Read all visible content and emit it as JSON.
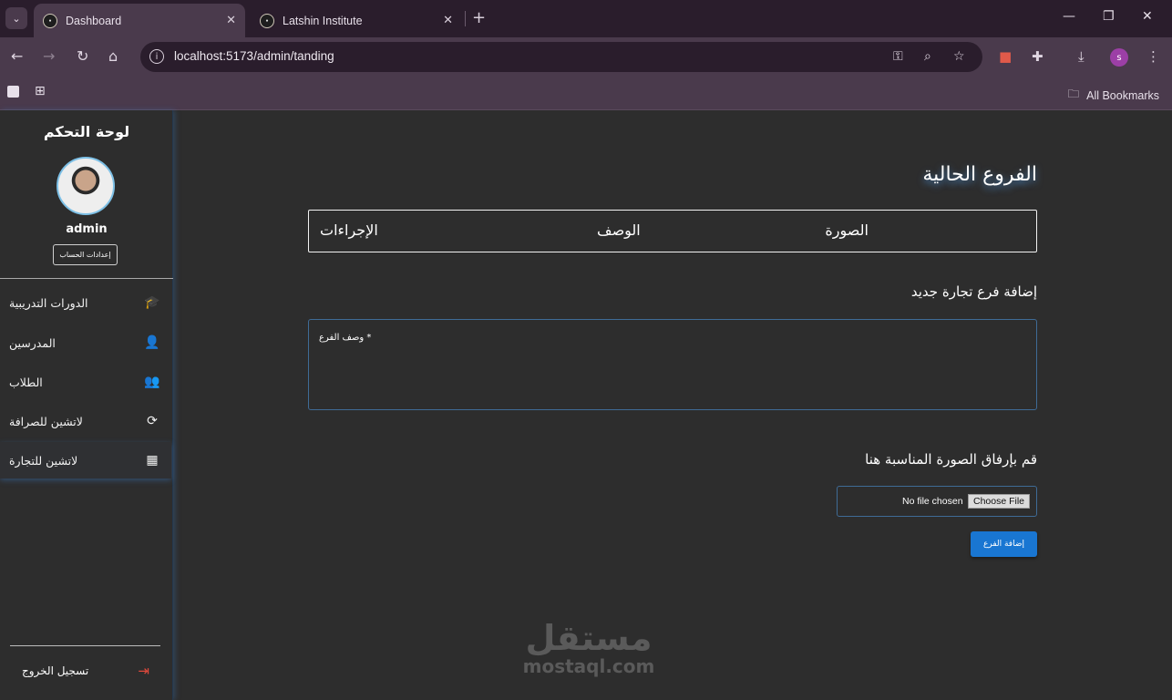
{
  "browser": {
    "tabs": [
      {
        "title": "Dashboard",
        "active": true
      },
      {
        "title": "Latshin Institute",
        "active": false
      }
    ],
    "url": "localhost:5173/admin/tanding",
    "bookmarks_label": "All Bookmarks",
    "profile_initial": "s"
  },
  "sidebar": {
    "title": "لوحة التحكم",
    "username": "admin",
    "settings_button": "إعدادات الحساب",
    "items": [
      {
        "label": "الدورات التدريبية",
        "icon": "graduation-cap-icon",
        "glyph": "🎓"
      },
      {
        "label": "المدرسين",
        "icon": "person-icon",
        "glyph": "👤"
      },
      {
        "label": "الطلاب",
        "icon": "people-icon",
        "glyph": "👥"
      },
      {
        "label": "لاتشين للصرافة",
        "icon": "currency-exchange-icon",
        "glyph": "⟳"
      },
      {
        "label": "لاتشين للتجارة",
        "icon": "building-icon",
        "glyph": "▦"
      }
    ],
    "logout_label": "تسجيل الخروج"
  },
  "main": {
    "heading": "الفروع الحالية",
    "table_headers": [
      "الصورة",
      "الوصف",
      "الإجراءات"
    ],
    "add_heading": "إضافة فرع تجارة جديد",
    "description_placeholder": "وصف الفرع *",
    "upload_heading": "قم بإرفاق الصورة المناسبة هنا",
    "file_status": "No file chosen",
    "choose_file": "Choose File",
    "add_button": "إضافة الفرع"
  },
  "watermark": {
    "arabic": "مستقل",
    "latin": "mostaql.com"
  }
}
